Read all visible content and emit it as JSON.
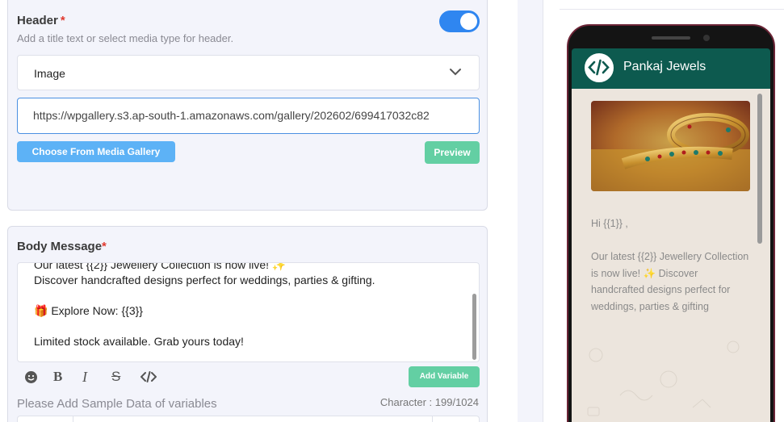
{
  "header_section": {
    "title": "Header",
    "required_mark": "*",
    "subtitle": "Add a title text or select media type for header.",
    "toggle_on": true,
    "media_type": "Image",
    "media_url": "https://wpgallery.s3.ap-south-1.amazonaws.com/gallery/202602/699417032c82",
    "choose_gallery_label": "Choose From Media Gallery",
    "preview_label": "Preview"
  },
  "body_section": {
    "title": "Body Message",
    "required_mark": "*",
    "lines": {
      "l1": "Our latest  {{2}}  Jewellery Collection is now live! ✨",
      "l2": "Discover handcrafted designs perfect for weddings, parties & gifting.",
      "l3": "🎁 Explore Now:  {{3}}",
      "l4": "Limited stock available. Grab yours today!"
    },
    "add_variable_label": "Add Variable",
    "sample_label": "Please Add Sample Data of variables",
    "char_count": "Character : 199/1024"
  },
  "preview": {
    "business_name": "Pankaj Jewels",
    "greeting": "Hi {{1}} ,",
    "para": "Our latest {{2}} Jewellery Collection is now live! ✨ Discover handcrafted designs perfect for weddings, parties & gifting"
  },
  "colors": {
    "accent_blue": "#2f86f0",
    "green_btn": "#63cfa3",
    "wa_header": "#0d5a4f"
  }
}
